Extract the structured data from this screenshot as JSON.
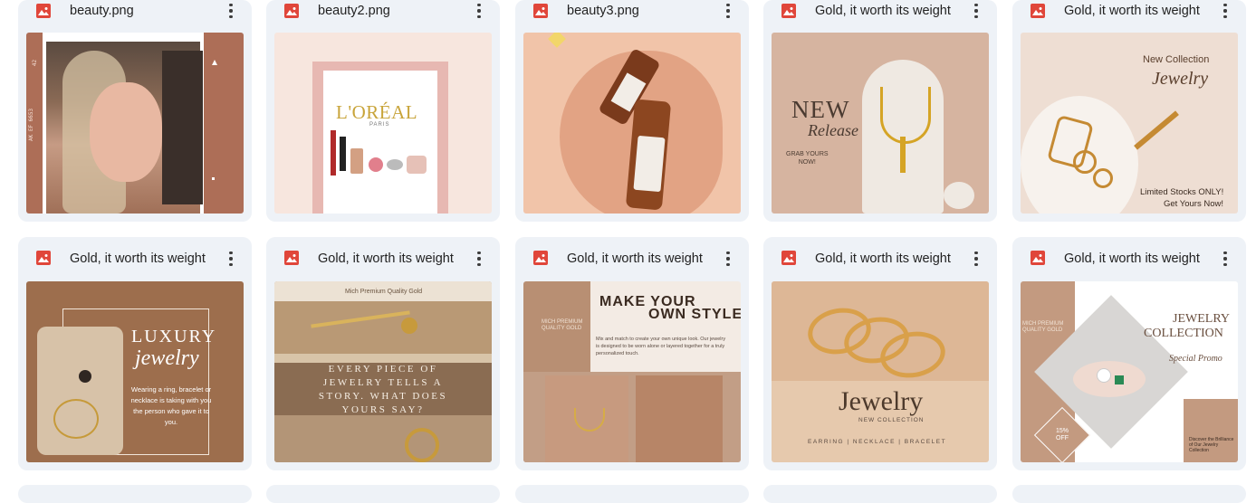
{
  "files": [
    {
      "name": "beauty.png",
      "thumb": {
        "side_left": "AK EF 6653",
        "side_right": "42"
      }
    },
    {
      "name": "beauty2.png",
      "thumb": {
        "brand": "L'ORÉAL",
        "brand_sub": "PARIS"
      }
    },
    {
      "name": "beauty3.png",
      "thumb": {}
    },
    {
      "name": "Gold, it worth its weight",
      "thumb": {
        "line1": "NEW",
        "line2": "Release",
        "line3": "GRAB YOURS\nNOW!"
      }
    },
    {
      "name": "Gold, it worth its weight",
      "thumb": {
        "line1": "New Collection",
        "line2": "Jewelry",
        "line3": "Limited Stocks ONLY!",
        "line4": "Get Yours Now!"
      }
    },
    {
      "name": "Gold, it worth its weight",
      "thumb": {
        "line1": "LUXURY",
        "line2": "jewelry",
        "line3": "Wearing a ring, bracelet or necklace is taking with you the person who gave it to you."
      }
    },
    {
      "name": "Gold, it worth its weight",
      "thumb": {
        "line1": "Mich Premium Quality Gold",
        "line2": "EVERY PIECE OF JEWELRY TELLS A STORY. WHAT DOES YOURS SAY?"
      }
    },
    {
      "name": "Gold, it worth its weight",
      "thumb": {
        "line1": "MAKE YOUR",
        "line2": "OWN STYLE",
        "line3": "MICH PREMIUM QUALITY GOLD",
        "line4": "Mix and match to create your own unique look. Our jewelry is designed to be worn alone or layered together for a truly personalized touch."
      }
    },
    {
      "name": "Gold, it worth its weight",
      "thumb": {
        "line1": "Jewelry",
        "line2": "NEW COLLECTION",
        "line3": "EARRING | NECKLACE | BRACELET"
      }
    },
    {
      "name": "Gold, it worth its weight",
      "thumb": {
        "line1": "JEWELRY",
        "line2": "COLLECTION",
        "line3": "Special Promo",
        "line4": "MICH PREMIUM QUALITY GOLD",
        "line5": "15% OFF",
        "line6": "Discover the Brilliance of Our Jewelry Collection"
      }
    }
  ],
  "colors": {
    "card_bg": "#eef2f7",
    "image_icon": "#e0463a"
  },
  "icons": {
    "file": "image-file-icon",
    "menu": "more-vert-icon"
  }
}
